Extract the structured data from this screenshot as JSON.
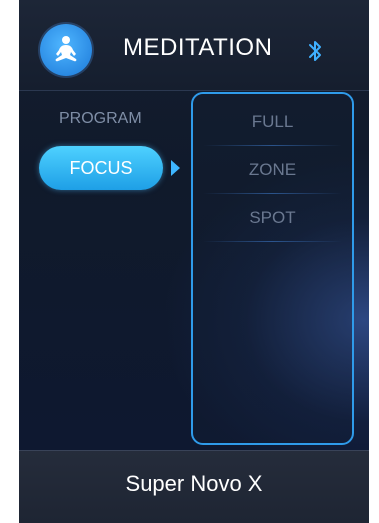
{
  "header": {
    "title": "MEDITATION",
    "logo_icon": "meditation-icon",
    "bluetooth_icon": "bluetooth-icon"
  },
  "sidebar": {
    "section_label": "PROGRAM",
    "selected_label": "FOCUS"
  },
  "options": [
    {
      "label": "FULL"
    },
    {
      "label": "ZONE"
    },
    {
      "label": "SPOT"
    }
  ],
  "footer": {
    "device_name": "Super Novo X"
  },
  "colors": {
    "accent": "#2f9bea",
    "selected": "#3fc1f8",
    "background": "#111a2b"
  }
}
